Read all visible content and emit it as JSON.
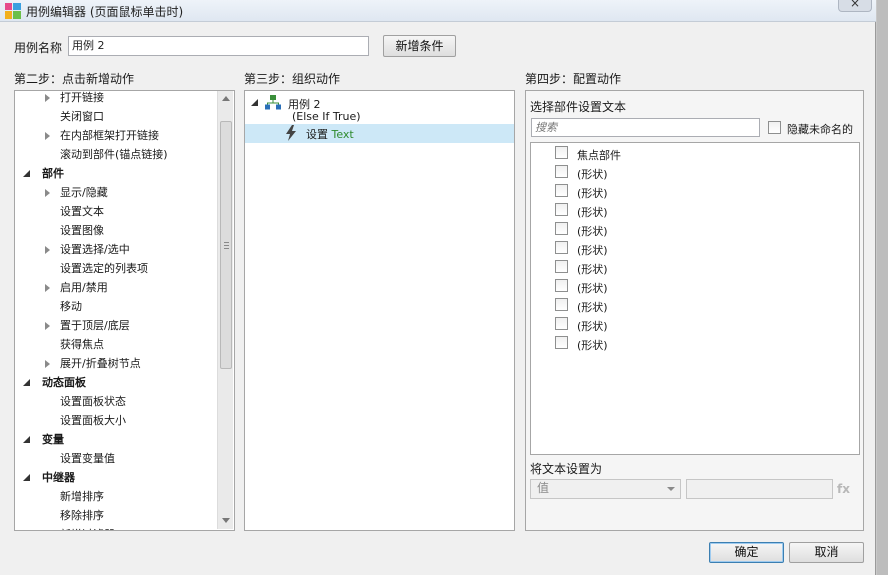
{
  "window": {
    "title": "用例编辑器 (页面鼠标单击时)",
    "close_glyph": "×"
  },
  "case_name": {
    "label": "用例名称",
    "value": "用例 2",
    "add_condition_button": "新增条件"
  },
  "step2": {
    "heading": "第二步：点击新增动作",
    "items": [
      {
        "label": "打开链接",
        "kind": "child-expand"
      },
      {
        "label": "关闭窗口",
        "kind": "child"
      },
      {
        "label": "在内部框架打开链接",
        "kind": "child-expand"
      },
      {
        "label": "滚动到部件(锚点链接)",
        "kind": "child"
      },
      {
        "label": "部件",
        "kind": "group"
      },
      {
        "label": "显示/隐藏",
        "kind": "child-expand"
      },
      {
        "label": "设置文本",
        "kind": "child"
      },
      {
        "label": "设置图像",
        "kind": "child"
      },
      {
        "label": "设置选择/选中",
        "kind": "child-expand"
      },
      {
        "label": "设置选定的列表项",
        "kind": "child"
      },
      {
        "label": "启用/禁用",
        "kind": "child-expand"
      },
      {
        "label": "移动",
        "kind": "child"
      },
      {
        "label": "置于顶层/底层",
        "kind": "child-expand"
      },
      {
        "label": "获得焦点",
        "kind": "child"
      },
      {
        "label": "展开/折叠树节点",
        "kind": "child-expand"
      },
      {
        "label": "动态面板",
        "kind": "group"
      },
      {
        "label": "设置面板状态",
        "kind": "child"
      },
      {
        "label": "设置面板大小",
        "kind": "child"
      },
      {
        "label": "变量",
        "kind": "group"
      },
      {
        "label": "设置变量值",
        "kind": "child"
      },
      {
        "label": "中继器",
        "kind": "group"
      },
      {
        "label": "新增排序",
        "kind": "child"
      },
      {
        "label": "移除排序",
        "kind": "child"
      },
      {
        "label": "新增过滤器",
        "kind": "child"
      }
    ]
  },
  "step3": {
    "heading": "第三步：组织动作",
    "case_label": "用例 2",
    "condition": "(Else If True)",
    "action_prefix": "设置 ",
    "action_target": "Text"
  },
  "step4": {
    "heading": "第四步：配置动作",
    "select_widget_label": "选择部件设置文本",
    "search_placeholder": "搜索",
    "hide_unnamed_label": "隐藏未命名的",
    "widgets": [
      "焦点部件",
      "(形状)",
      "(形状)",
      "(形状)",
      "(形状)",
      "(形状)",
      "(形状)",
      "(形状)",
      "(形状)",
      "(形状)",
      "(形状)"
    ],
    "set_text_label": "将文本设置为",
    "value_type": "值",
    "fx_label": "fx"
  },
  "footer": {
    "ok_button": "确定",
    "cancel_button": "取消"
  },
  "colors": {
    "action_target": "#2e8b2e",
    "selection": "#cde8f7"
  }
}
